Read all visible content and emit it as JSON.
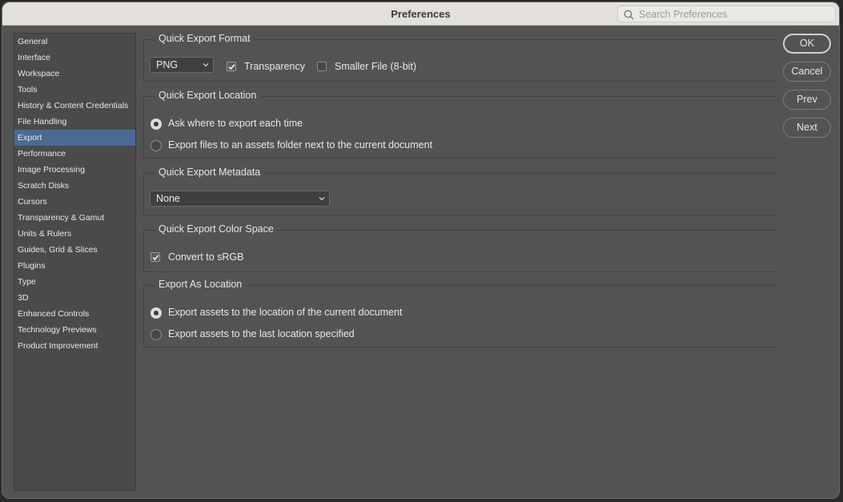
{
  "window": {
    "title": "Preferences"
  },
  "search": {
    "placeholder": "Search Preferences",
    "icon": "search-icon"
  },
  "sidebar": {
    "active_index": 6,
    "items": [
      {
        "label": "General"
      },
      {
        "label": "Interface"
      },
      {
        "label": "Workspace"
      },
      {
        "label": "Tools"
      },
      {
        "label": "History & Content Credentials"
      },
      {
        "label": "File Handling"
      },
      {
        "label": "Export"
      },
      {
        "label": "Performance"
      },
      {
        "label": "Image Processing"
      },
      {
        "label": "Scratch Disks"
      },
      {
        "label": "Cursors"
      },
      {
        "label": "Transparency & Gamut"
      },
      {
        "label": "Units & Rulers"
      },
      {
        "label": "Guides, Grid & Slices"
      },
      {
        "label": "Plugins"
      },
      {
        "label": "Type"
      },
      {
        "label": "3D"
      },
      {
        "label": "Enhanced Controls"
      },
      {
        "label": "Technology Previews"
      },
      {
        "label": "Product Improvement"
      }
    ]
  },
  "quick_export_format": {
    "title": "Quick Export Format",
    "format_value": "PNG",
    "transparency": {
      "label": "Transparency",
      "checked": true
    },
    "smaller_file": {
      "label": "Smaller File (8-bit)",
      "checked": false
    }
  },
  "quick_export_location": {
    "title": "Quick Export Location",
    "options": [
      {
        "label": "Ask where to export each time",
        "selected": true
      },
      {
        "label": "Export files to an assets folder next to the current document",
        "selected": false
      }
    ]
  },
  "quick_export_metadata": {
    "title": "Quick Export Metadata",
    "value": "None"
  },
  "quick_export_color_space": {
    "title": "Quick Export Color Space",
    "convert_srgb": {
      "label": "Convert to sRGB",
      "checked": true
    }
  },
  "export_as_location": {
    "title": "Export As Location",
    "options": [
      {
        "label": "Export assets to the location of the current document",
        "selected": true
      },
      {
        "label": "Export assets to the last location specified",
        "selected": false
      }
    ]
  },
  "buttons": {
    "ok": "OK",
    "cancel": "Cancel",
    "prev": "Prev",
    "next": "Next"
  },
  "colors": {
    "panel_bg": "#535353",
    "sidebar_bg": "#4a4a4a",
    "selection": "#4b6a93",
    "titlebar": "#e3e0dc"
  }
}
